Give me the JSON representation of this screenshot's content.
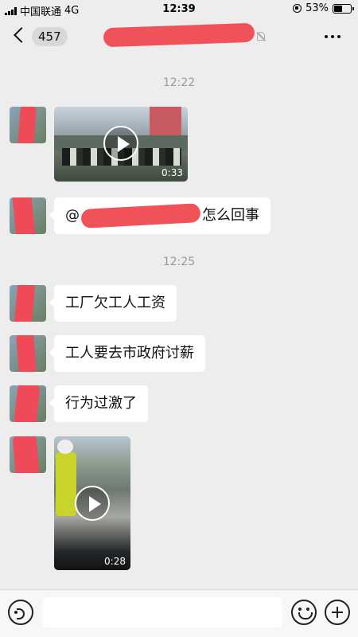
{
  "status_bar": {
    "carrier": "中国联通",
    "network": "4G",
    "time": "12:39",
    "battery": "53%",
    "battery_level": 0.53
  },
  "nav": {
    "unread_count": "457",
    "title_redacted": true
  },
  "messages": [
    {
      "type": "time",
      "text": "12:22"
    },
    {
      "type": "video",
      "duration": "0:33"
    },
    {
      "type": "text",
      "prefix": "@",
      "suffix": "怎么回事"
    },
    {
      "type": "time",
      "text": "12:25"
    },
    {
      "type": "text",
      "text": "工厂欠工人工资"
    },
    {
      "type": "text",
      "text": "工人要去市政府讨薪"
    },
    {
      "type": "text",
      "text": "行为过激了"
    },
    {
      "type": "video",
      "duration": "0:28"
    }
  ],
  "colors": {
    "background": "#ededed",
    "bubble": "#ffffff",
    "redaction": "#f0525a"
  },
  "icons": [
    "back-icon",
    "mute-bell-icon",
    "more-icon",
    "play-icon",
    "voice-icon",
    "emoji-icon",
    "plus-icon"
  ]
}
